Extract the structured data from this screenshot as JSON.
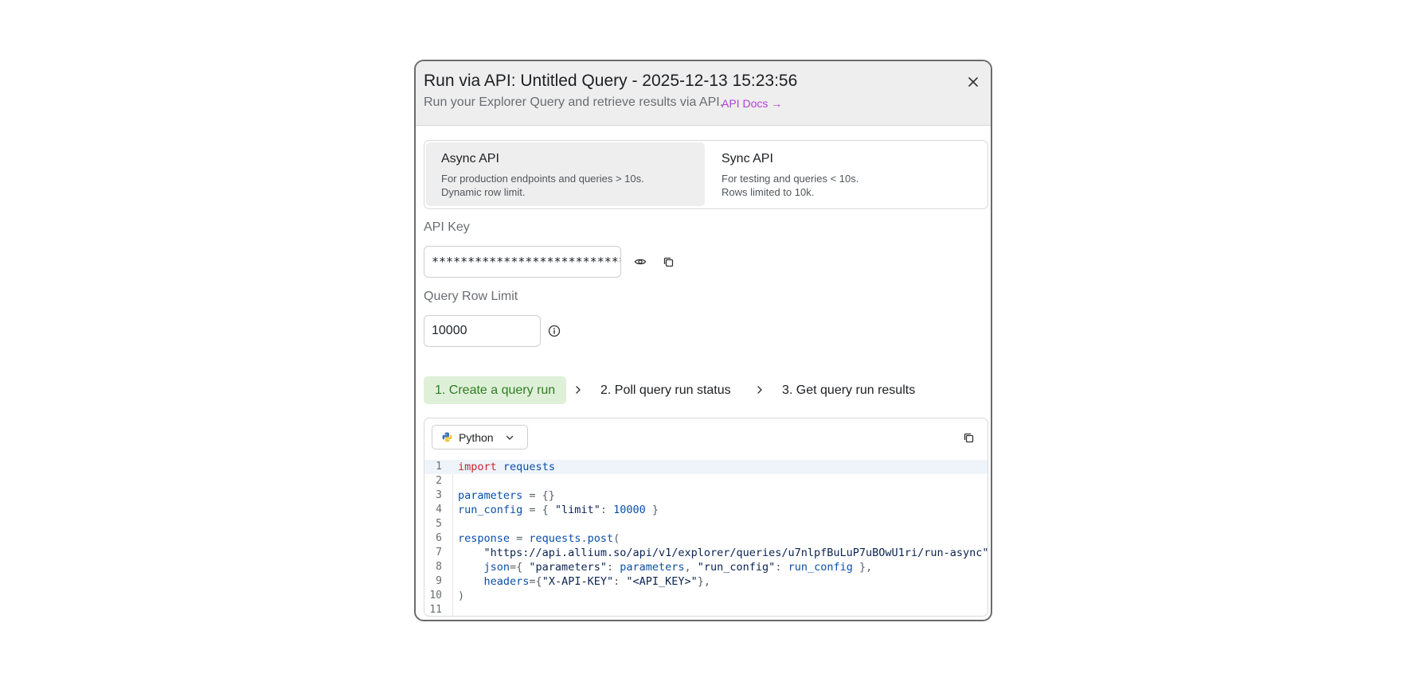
{
  "modal": {
    "title": "Run via API: Untitled Query - 2025-12-13 15:23:56",
    "subtitle": "Run your Explorer Query and retrieve results via API.",
    "docs_link": "API Docs →"
  },
  "api_modes": [
    {
      "name": "Async API",
      "desc": "For production endpoints and queries > 10s.\nDynamic row limit.",
      "selected": true
    },
    {
      "name": "Sync API",
      "desc": "For testing and queries < 10s.\nRows limited to 10k.",
      "selected": false
    }
  ],
  "api_key": {
    "label": "API Key",
    "value": "************************************************"
  },
  "row_limit": {
    "label": "Query Row Limit",
    "value": "10000"
  },
  "steps": [
    {
      "label": "1. Create a query run",
      "active": true
    },
    {
      "label": "2. Poll query run status",
      "active": false
    },
    {
      "label": "3. Get query run results",
      "active": false
    }
  ],
  "code": {
    "language": "Python",
    "lines": [
      "import requests",
      "",
      "parameters = {}",
      "run_config = { \"limit\": 10000 }",
      "",
      "response = requests.post(",
      "    \"https://api.allium.so/api/v1/explorer/queries/u7nlpfBuLuP7uBOwU1ri/run-async\",",
      "    json={ \"parameters\": parameters, \"run_config\": run_config },",
      "    headers={\"X-API-KEY\": \"<API_KEY>\"},",
      ")",
      ""
    ],
    "line_numbers": [
      "1",
      "2",
      "3",
      "4",
      "5",
      "6",
      "7",
      "8",
      "9",
      "10",
      "11"
    ]
  },
  "colors": {
    "active_step_bg": "#dff0d8",
    "active_step_text": "#2f7d22",
    "link": "#b43fd6",
    "keyword": "#cf222e",
    "identifier": "#0a4fa8"
  },
  "icons": {
    "close": "close-icon",
    "show_key": "eye-icon",
    "copy_key": "copy-icon",
    "info": "info-icon",
    "python": "python-logo-icon",
    "dropdown": "chevron-down-icon",
    "copy_code": "copy-icon"
  }
}
